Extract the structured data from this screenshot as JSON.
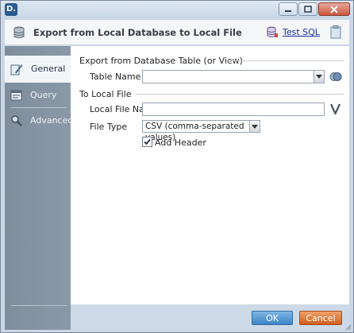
{
  "window": {
    "app_icon_text": "D."
  },
  "header": {
    "title": "Export from Local Database to Local File",
    "test_sql_label": "Test SQL"
  },
  "sidebar": {
    "items": [
      {
        "label": "General",
        "icon": "settings-pencil-icon",
        "active": true
      },
      {
        "label": "Query",
        "icon": "query-icon",
        "active": false
      },
      {
        "label": "Advanced",
        "icon": "advanced-magnifier-icon",
        "active": false
      }
    ]
  },
  "form": {
    "section_export": "Export from Database Table (or View)",
    "table_name_label": "Table Name",
    "table_name_value": "",
    "section_local": "To Local File",
    "local_file_name_label": "Local File Name",
    "local_file_name_value": "",
    "file_type_label": "File Type",
    "file_type_value": "CSV (comma-separated values)",
    "add_header_label": "Add Header",
    "add_header_checked": true
  },
  "footer": {
    "ok_label": "OK",
    "cancel_label": "Cancel"
  },
  "colors": {
    "accent": "#3d84c6",
    "cancel": "#cf5e1c",
    "sidebar": "#8a99a9"
  }
}
